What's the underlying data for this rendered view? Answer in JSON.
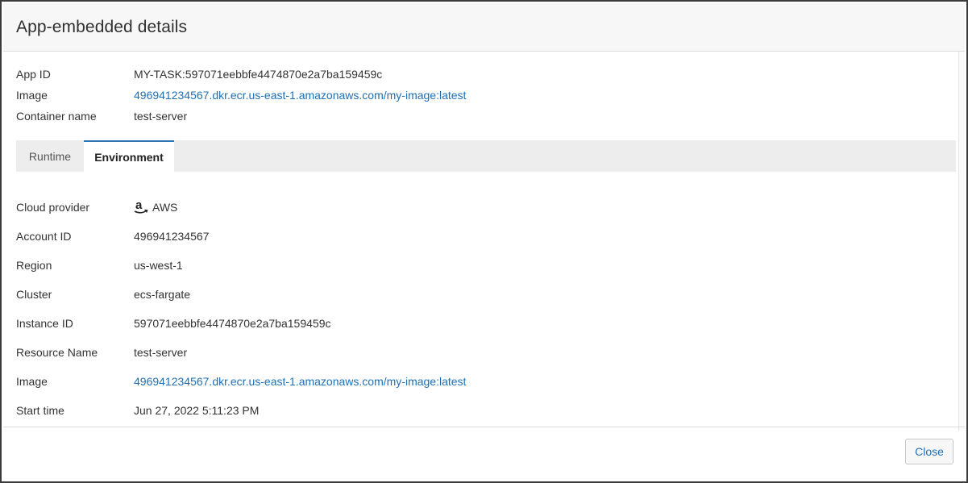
{
  "dialog": {
    "title": "App-embedded details",
    "close_label": "Close"
  },
  "summary": [
    {
      "label": "App ID",
      "value": "MY-TASK:597071eebbfe4474870e2a7ba159459c"
    },
    {
      "label": "Image",
      "value": "496941234567.dkr.ecr.us-east-1.amazonaws.com/my-image:latest"
    },
    {
      "label": "Container name",
      "value": "test-server"
    }
  ],
  "tabs": [
    {
      "label": "Runtime",
      "selected": false
    },
    {
      "label": "Environment",
      "selected": true
    }
  ],
  "environment": {
    "cloud_provider": {
      "label": "Cloud provider",
      "value": "AWS",
      "icon": "amazon-logo-icon"
    },
    "account_id": {
      "label": "Account ID",
      "value": "496941234567"
    },
    "region": {
      "label": "Region",
      "value": "us-west-1"
    },
    "cluster": {
      "label": "Cluster",
      "value": "ecs-fargate"
    },
    "instance_id": {
      "label": "Instance ID",
      "value": "597071eebbfe4474870e2a7ba159459c"
    },
    "resource_name": {
      "label": "Resource Name",
      "value": "test-server"
    },
    "image": {
      "label": "Image",
      "value": "496941234567.dkr.ecr.us-east-1.amazonaws.com/my-image:latest"
    },
    "start_time": {
      "label": "Start time",
      "value": "Jun 27, 2022 5:11:23 PM"
    }
  },
  "colors": {
    "link": "#1f6fb5",
    "tab_accent": "#2f73b5",
    "tab_bar": "#ededed"
  }
}
